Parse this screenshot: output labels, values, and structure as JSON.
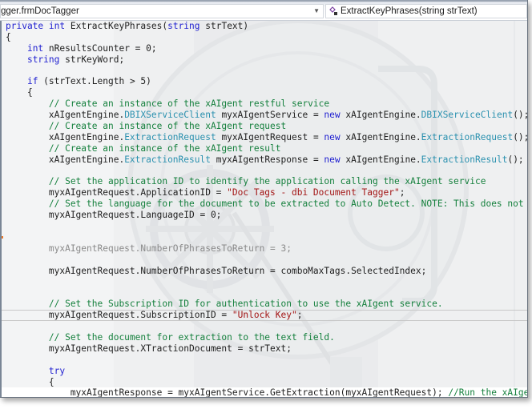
{
  "navigation": {
    "class_combo": "gger.frmDocTagger",
    "member_combo": "ExtractKeyPhrases(string strText)",
    "member_icon": "method-private-icon",
    "dropdown_icon": "chevron-down-icon"
  },
  "editor": {
    "lines": [
      [
        {
          "t": "private ",
          "c": "kw"
        },
        {
          "t": "int ",
          "c": "kw"
        },
        {
          "t": "ExtractKeyPhrases(",
          "c": ""
        },
        {
          "t": "string ",
          "c": "kw"
        },
        {
          "t": "strText)",
          "c": ""
        }
      ],
      [
        {
          "t": "{",
          "c": ""
        }
      ],
      [
        {
          "t": "    ",
          "c": ""
        },
        {
          "t": "int ",
          "c": "kw"
        },
        {
          "t": "nResultsCounter = 0;",
          "c": ""
        }
      ],
      [
        {
          "t": "    ",
          "c": ""
        },
        {
          "t": "string ",
          "c": "kw"
        },
        {
          "t": "strKeyWord;",
          "c": ""
        }
      ],
      [],
      [
        {
          "t": "    ",
          "c": ""
        },
        {
          "t": "if ",
          "c": "kw"
        },
        {
          "t": "(strText.Length > 5)",
          "c": ""
        }
      ],
      [
        {
          "t": "    {",
          "c": ""
        }
      ],
      [
        {
          "t": "        // Create an instance of the xAIgent restful service",
          "c": "cm"
        }
      ],
      [
        {
          "t": "        xAIgentEngine.",
          "c": ""
        },
        {
          "t": "DBIXServiceClient",
          "c": "ty"
        },
        {
          "t": " myxAIgentService = ",
          "c": ""
        },
        {
          "t": "new ",
          "c": "kw"
        },
        {
          "t": "xAIgentEngine.",
          "c": ""
        },
        {
          "t": "DBIXServiceClient",
          "c": "ty"
        },
        {
          "t": "();",
          "c": ""
        }
      ],
      [
        {
          "t": "        // Create an instance of the xAIgent request",
          "c": "cm"
        }
      ],
      [
        {
          "t": "        xAIgentEngine.",
          "c": ""
        },
        {
          "t": "ExtractionRequest",
          "c": "ty"
        },
        {
          "t": " myxAIgentRequest = ",
          "c": ""
        },
        {
          "t": "new ",
          "c": "kw"
        },
        {
          "t": "xAIgentEngine.",
          "c": ""
        },
        {
          "t": "ExtractionRequest",
          "c": "ty"
        },
        {
          "t": "();",
          "c": ""
        }
      ],
      [
        {
          "t": "        // Create an instance of the xAIgent result",
          "c": "cm"
        }
      ],
      [
        {
          "t": "        xAIgentEngine.",
          "c": ""
        },
        {
          "t": "ExtractionResult",
          "c": "ty"
        },
        {
          "t": " myxAIgentResponse = ",
          "c": ""
        },
        {
          "t": "new ",
          "c": "kw"
        },
        {
          "t": "xAIgentEngine.",
          "c": ""
        },
        {
          "t": "ExtractionResult",
          "c": "ty"
        },
        {
          "t": "();",
          "c": ""
        }
      ],
      [],
      [
        {
          "t": "        // Set the application ID to identify the application calling the xAIgent service",
          "c": "cm"
        }
      ],
      [
        {
          "t": "        myxAIgentRequest.ApplicationID = ",
          "c": ""
        },
        {
          "t": "\"Doc Tags - dbi Document Tagger\"",
          "c": "st"
        },
        {
          "t": ";",
          "c": ""
        }
      ],
      [
        {
          "t": "        // Set the language for the document to be extracted to Auto Detect. NOTE: This does not work with",
          "c": "cm"
        }
      ],
      [
        {
          "t": "        myxAIgentRequest.LanguageID = 0;",
          "c": ""
        }
      ],
      [],
      [],
      [
        {
          "t": "        myxAIgentRequest.NumberOfPhrasesToReturn = 3;",
          "c": "gr"
        }
      ],
      [],
      [
        {
          "t": "        myxAIgentRequest.NumberOfPhrasesToReturn = comboMaxTags.SelectedIndex;",
          "c": ""
        }
      ],
      [],
      [],
      [
        {
          "t": "        // Set the Subscription ID for authentication to use the xAIgent service.",
          "c": "cm"
        }
      ],
      [
        {
          "t": "        myxAIgentRequest.SubscriptionID = ",
          "c": ""
        },
        {
          "t": "\"Unlock Key\"",
          "c": "st"
        },
        {
          "t": ";",
          "c": ""
        }
      ],
      [],
      [
        {
          "t": "        // Set the document for extraction to the text field.",
          "c": "cm"
        }
      ],
      [
        {
          "t": "        myxAIgentRequest.XTractionDocument = strText;",
          "c": ""
        }
      ],
      [],
      [
        {
          "t": "        ",
          "c": ""
        },
        {
          "t": "try",
          "c": "kw"
        }
      ],
      [
        {
          "t": "        {",
          "c": ""
        }
      ],
      [
        {
          "t": "            myxAIgentResponse = myxAIgentService.GetExtraction(myxAIgentRequest); ",
          "c": ""
        },
        {
          "t": "//Run the xAIgent Service",
          "c": "cm"
        }
      ]
    ]
  }
}
